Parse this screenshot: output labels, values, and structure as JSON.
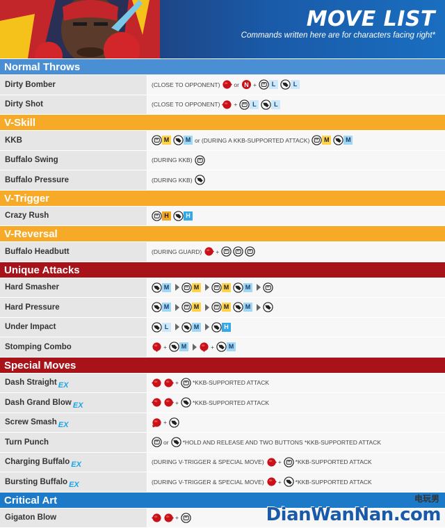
{
  "header": {
    "title": "MOVE LIST",
    "subtitle": "Commands written here are for characters facing right*"
  },
  "colors": {
    "blue_section": "#4a8fd4",
    "yellow_section": "#f7a928",
    "red_section": "#a8131a",
    "critical_section": "#1c7ac8"
  },
  "sections": [
    {
      "label": "Normal Throws",
      "color": "#4a8fd4",
      "moves": [
        {
          "name": "Dirty Bomber",
          "ex": false,
          "cmd": [
            {
              "t": "text",
              "v": "(CLOSE TO OPPONENT)"
            },
            {
              "t": "dir",
              "v": "fwd"
            },
            {
              "t": "text",
              "v": "or"
            },
            {
              "t": "neutral",
              "v": "N"
            },
            {
              "t": "text",
              "v": "+"
            },
            {
              "t": "punch",
              "b": "L",
              "c": "L"
            },
            {
              "t": "kick",
              "b": "L",
              "c": "L"
            }
          ]
        },
        {
          "name": "Dirty Shot",
          "ex": false,
          "cmd": [
            {
              "t": "text",
              "v": "(CLOSE TO OPPONENT)"
            },
            {
              "t": "dir",
              "v": "back"
            },
            {
              "t": "text",
              "v": "+"
            },
            {
              "t": "punch",
              "b": "L",
              "c": "L"
            },
            {
              "t": "kick",
              "b": "L",
              "c": "L"
            }
          ]
        }
      ]
    },
    {
      "label": "V-Skill",
      "color": "#f7a928",
      "moves": [
        {
          "name": "KKB",
          "ex": false,
          "cmd": [
            {
              "t": "punch",
              "b": "M",
              "c": "M"
            },
            {
              "t": "kick",
              "b": "M",
              "c": "Mb"
            },
            {
              "t": "text",
              "v": "or (DURING A KKB-SUPPORTED ATTACK)"
            },
            {
              "t": "punch",
              "b": "M",
              "c": "M"
            },
            {
              "t": "kick",
              "b": "M",
              "c": "Mb"
            }
          ]
        },
        {
          "name": "Buffalo Swing",
          "ex": false,
          "cmd": [
            {
              "t": "text",
              "v": "(DURING KKB)"
            },
            {
              "t": "punch"
            }
          ]
        },
        {
          "name": "Buffalo Pressure",
          "ex": false,
          "cmd": [
            {
              "t": "text",
              "v": "(DURING KKB)"
            },
            {
              "t": "kick"
            }
          ]
        }
      ]
    },
    {
      "label": "V-Trigger",
      "color": "#f7a928",
      "moves": [
        {
          "name": "Crazy Rush",
          "ex": false,
          "cmd": [
            {
              "t": "punch",
              "b": "H",
              "c": "Hy"
            },
            {
              "t": "kick",
              "b": "H",
              "c": "Hb"
            }
          ]
        }
      ]
    },
    {
      "label": "V-Reversal",
      "color": "#f7a928",
      "moves": [
        {
          "name": "Buffalo Headbutt",
          "ex": false,
          "cmd": [
            {
              "t": "text",
              "v": "(DURING GUARD)"
            },
            {
              "t": "dir",
              "v": "fwd"
            },
            {
              "t": "text",
              "v": "+"
            },
            {
              "t": "punch"
            },
            {
              "t": "punch"
            },
            {
              "t": "punch"
            }
          ]
        }
      ]
    },
    {
      "label": "Unique Attacks",
      "color": "#a8131a",
      "moves": [
        {
          "name": "Hard Smasher",
          "ex": false,
          "cmd": [
            {
              "t": "kick",
              "b": "M",
              "c": "Mb"
            },
            {
              "t": "sep"
            },
            {
              "t": "punch",
              "b": "M",
              "c": "M"
            },
            {
              "t": "sep"
            },
            {
              "t": "punch",
              "b": "M",
              "c": "M"
            },
            {
              "t": "kick",
              "b": "M",
              "c": "Mb"
            },
            {
              "t": "sep"
            },
            {
              "t": "punch"
            }
          ]
        },
        {
          "name": "Hard Pressure",
          "ex": false,
          "cmd": [
            {
              "t": "kick",
              "b": "M",
              "c": "Mb"
            },
            {
              "t": "sep"
            },
            {
              "t": "punch",
              "b": "M",
              "c": "M"
            },
            {
              "t": "sep"
            },
            {
              "t": "punch",
              "b": "M",
              "c": "M"
            },
            {
              "t": "kick",
              "b": "M",
              "c": "Mb"
            },
            {
              "t": "sep"
            },
            {
              "t": "kick"
            }
          ]
        },
        {
          "name": "Under Impact",
          "ex": false,
          "cmd": [
            {
              "t": "kick",
              "b": "L",
              "c": "L"
            },
            {
              "t": "sep"
            },
            {
              "t": "kick",
              "b": "M",
              "c": "Mb"
            },
            {
              "t": "sep"
            },
            {
              "t": "kick",
              "b": "H",
              "c": "Hb"
            }
          ]
        },
        {
          "name": "Stomping Combo",
          "ex": false,
          "cmd": [
            {
              "t": "dir",
              "v": "down"
            },
            {
              "t": "text",
              "v": "+"
            },
            {
              "t": "kick",
              "b": "M",
              "c": "Mb"
            },
            {
              "t": "sep"
            },
            {
              "t": "dir",
              "v": "down"
            },
            {
              "t": "text",
              "v": "+"
            },
            {
              "t": "kick",
              "b": "M",
              "c": "Mb"
            }
          ]
        }
      ]
    },
    {
      "label": "Special Moves",
      "color": "#a8131a",
      "moves": [
        {
          "name": "Dash Straight",
          "ex": true,
          "cmd": [
            {
              "t": "dir",
              "v": "back"
            },
            {
              "t": "dir",
              "v": "fwd"
            },
            {
              "t": "text",
              "v": "+"
            },
            {
              "t": "punch"
            },
            {
              "t": "text",
              "v": "*KKB-SUPPORTED ATTACK"
            }
          ]
        },
        {
          "name": "Dash Grand Blow",
          "ex": true,
          "cmd": [
            {
              "t": "dir",
              "v": "back"
            },
            {
              "t": "dir",
              "v": "fwd"
            },
            {
              "t": "text",
              "v": "+"
            },
            {
              "t": "kick"
            },
            {
              "t": "text",
              "v": "*KKB-SUPPORTED ATTACK"
            }
          ]
        },
        {
          "name": "Screw Smash",
          "ex": true,
          "cmd": [
            {
              "t": "dir",
              "v": "downback"
            },
            {
              "t": "text",
              "v": "+"
            },
            {
              "t": "kick"
            }
          ]
        },
        {
          "name": "Turn Punch",
          "ex": false,
          "cmd": [
            {
              "t": "punch"
            },
            {
              "t": "text",
              "v": "or"
            },
            {
              "t": "kick"
            },
            {
              "t": "text",
              "v": "*HOLD AND RELEASE AND TWO BUTTONS *KKB-SUPPORTED ATTACK"
            }
          ]
        },
        {
          "name": "Charging Buffalo",
          "ex": true,
          "cmd": [
            {
              "t": "text",
              "v": "(DURING V-TRIGGER & SPECIAL MOVE)"
            },
            {
              "t": "dir",
              "v": "fwd"
            },
            {
              "t": "text",
              "v": "+"
            },
            {
              "t": "punch"
            },
            {
              "t": "text",
              "v": "*KKB-SUPPORTED ATTACK"
            }
          ]
        },
        {
          "name": "Bursting Buffalo",
          "ex": true,
          "cmd": [
            {
              "t": "text",
              "v": "(DURING V-TRIGGER & SPECIAL MOVE)"
            },
            {
              "t": "dir",
              "v": "fwd"
            },
            {
              "t": "text",
              "v": "+"
            },
            {
              "t": "kick"
            },
            {
              "t": "text",
              "v": "*KKB-SUPPORTED ATTACK"
            }
          ]
        }
      ]
    },
    {
      "label": "Critical Art",
      "color": "#1c7ac8",
      "moves": [
        {
          "name": "Gigaton Blow",
          "ex": false,
          "cmd": [
            {
              "t": "dir",
              "v": "back"
            },
            {
              "t": "dir",
              "v": "fwd"
            },
            {
              "t": "text",
              "v": "+"
            },
            {
              "t": "punch"
            }
          ]
        }
      ]
    }
  ],
  "ex_label": "EX",
  "watermark": {
    "text": "DianWanNan.com",
    "cn": "电玩男"
  }
}
